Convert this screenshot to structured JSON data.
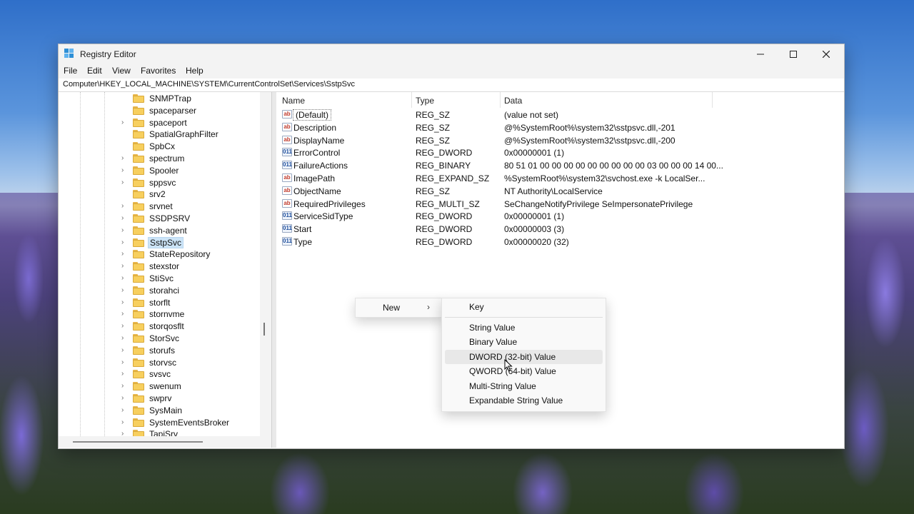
{
  "window": {
    "title": "Registry Editor"
  },
  "menu": [
    "File",
    "Edit",
    "View",
    "Favorites",
    "Help"
  ],
  "address": "Computer\\HKEY_LOCAL_MACHINE\\SYSTEM\\CurrentControlSet\\Services\\SstpSvc",
  "tree": [
    {
      "label": "SNMPTrap",
      "expandable": false
    },
    {
      "label": "spaceparser",
      "expandable": false
    },
    {
      "label": "spaceport",
      "expandable": true
    },
    {
      "label": "SpatialGraphFilter",
      "expandable": false
    },
    {
      "label": "SpbCx",
      "expandable": false
    },
    {
      "label": "spectrum",
      "expandable": true
    },
    {
      "label": "Spooler",
      "expandable": true
    },
    {
      "label": "sppsvc",
      "expandable": true
    },
    {
      "label": "srv2",
      "expandable": false
    },
    {
      "label": "srvnet",
      "expandable": true
    },
    {
      "label": "SSDPSRV",
      "expandable": true
    },
    {
      "label": "ssh-agent",
      "expandable": true
    },
    {
      "label": "SstpSvc",
      "expandable": true,
      "selected": true
    },
    {
      "label": "StateRepository",
      "expandable": true
    },
    {
      "label": "stexstor",
      "expandable": true
    },
    {
      "label": "StiSvc",
      "expandable": true
    },
    {
      "label": "storahci",
      "expandable": true
    },
    {
      "label": "storflt",
      "expandable": true
    },
    {
      "label": "stornvme",
      "expandable": true
    },
    {
      "label": "storqosflt",
      "expandable": true
    },
    {
      "label": "StorSvc",
      "expandable": true
    },
    {
      "label": "storufs",
      "expandable": true
    },
    {
      "label": "storvsc",
      "expandable": true
    },
    {
      "label": "svsvc",
      "expandable": true
    },
    {
      "label": "swenum",
      "expandable": true
    },
    {
      "label": "swprv",
      "expandable": true
    },
    {
      "label": "SysMain",
      "expandable": true
    },
    {
      "label": "SystemEventsBroker",
      "expandable": true
    },
    {
      "label": "TapiSrv",
      "expandable": true
    }
  ],
  "columns": {
    "name": "Name",
    "type": "Type",
    "data": "Data"
  },
  "values": [
    {
      "name": "(Default)",
      "type": "REG_SZ",
      "data": "(value not set)",
      "icon": "ab"
    },
    {
      "name": "Description",
      "type": "REG_SZ",
      "data": "@%SystemRoot%\\system32\\sstpsvc.dll,-201",
      "icon": "ab"
    },
    {
      "name": "DisplayName",
      "type": "REG_SZ",
      "data": "@%SystemRoot%\\system32\\sstpsvc.dll,-200",
      "icon": "ab"
    },
    {
      "name": "ErrorControl",
      "type": "REG_DWORD",
      "data": "0x00000001 (1)",
      "icon": "bin"
    },
    {
      "name": "FailureActions",
      "type": "REG_BINARY",
      "data": "80 51 01 00 00 00 00 00 00 00 00 00 03 00 00 00 14 00...",
      "icon": "bin"
    },
    {
      "name": "ImagePath",
      "type": "REG_EXPAND_SZ",
      "data": "%SystemRoot%\\system32\\svchost.exe -k LocalSer...",
      "icon": "ab"
    },
    {
      "name": "ObjectName",
      "type": "REG_SZ",
      "data": "NT Authority\\LocalService",
      "icon": "ab"
    },
    {
      "name": "RequiredPrivileges",
      "type": "REG_MULTI_SZ",
      "data": "SeChangeNotifyPrivilege SeImpersonatePrivilege",
      "icon": "ab"
    },
    {
      "name": "ServiceSidType",
      "type": "REG_DWORD",
      "data": "0x00000001 (1)",
      "icon": "bin"
    },
    {
      "name": "Start",
      "type": "REG_DWORD",
      "data": "0x00000003 (3)",
      "icon": "bin"
    },
    {
      "name": "Type",
      "type": "REG_DWORD",
      "data": "0x00000020 (32)",
      "icon": "bin"
    }
  ],
  "context_menu": {
    "new_label": "New",
    "submenu": [
      "Key",
      "String Value",
      "Binary Value",
      "DWORD (32-bit) Value",
      "QWORD (64-bit) Value",
      "Multi-String Value",
      "Expandable String Value"
    ],
    "hovered": "DWORD (32-bit) Value"
  },
  "colors": {
    "selection": "#cce4f7",
    "folder": "#f7cf5e",
    "hover": "#e8e8e8"
  }
}
